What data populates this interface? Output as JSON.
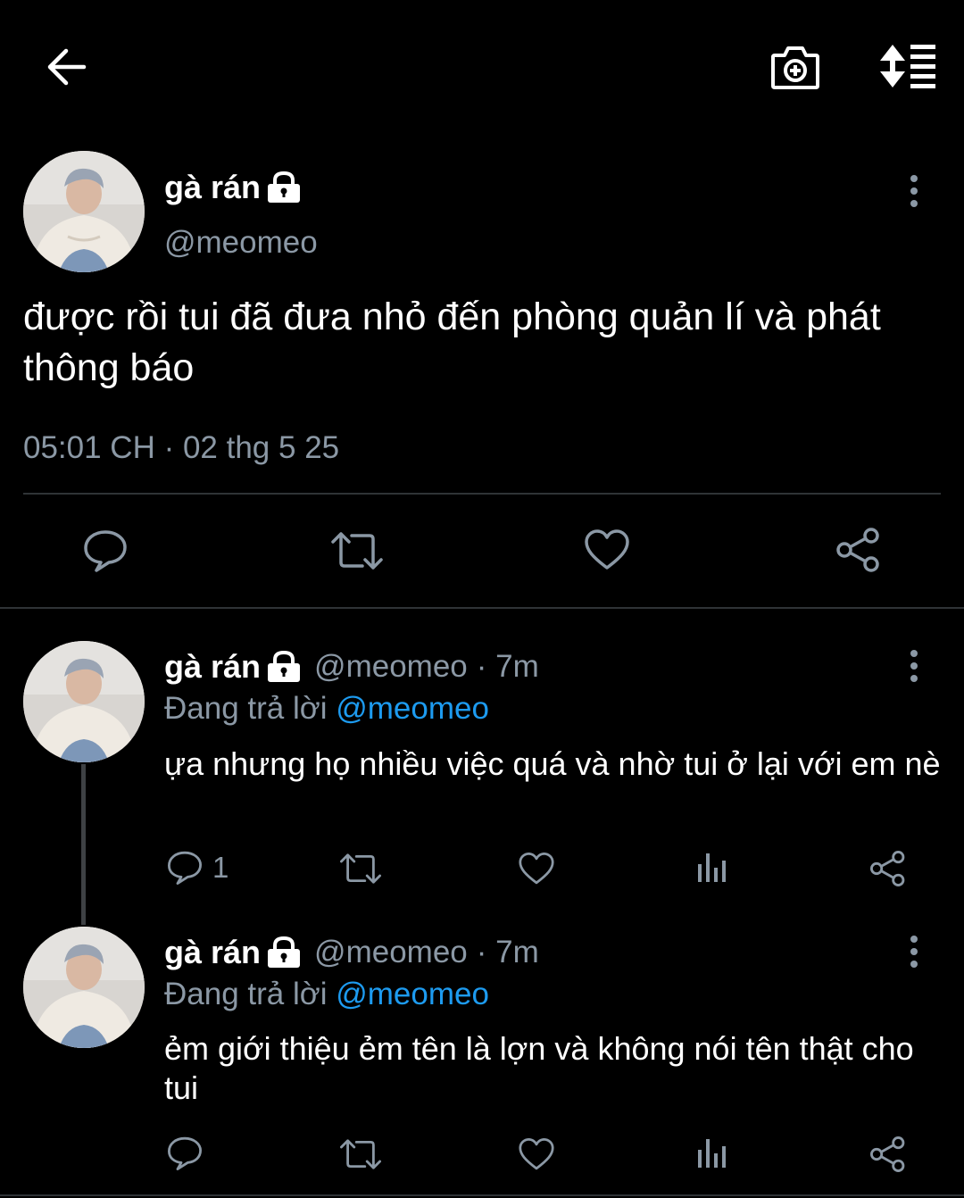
{
  "topbar": {
    "back_icon": "arrow-left-icon",
    "camera_icon": "camera-add-icon",
    "sort_icon": "sort-thread-icon"
  },
  "main_tweet": {
    "display_name": "gà rán",
    "handle": "@meomeo",
    "text": "được rồi tui đã đưa nhỏ đến phòng quản lí và phát thông báo",
    "timestamp": "05:01 CH · 02 thg 5 25"
  },
  "replies": [
    {
      "display_name": "gà rán",
      "handle": "@meomeo",
      "time": "· 7m",
      "replying_prefix": "Đang trả lời",
      "replying_to": "@meomeo",
      "text": "ựa nhưng họ nhiều việc quá và nhờ tui ở lại với em nè",
      "reply_count": "1"
    },
    {
      "display_name": "gà rán",
      "handle": "@meomeo",
      "time": "· 7m",
      "replying_prefix": "Đang trả lời",
      "replying_to": "@meomeo",
      "text": "ẻm giới thiệu ẻm tên là lợn và không nói tên thật cho tui",
      "reply_count": ""
    }
  ],
  "colors": {
    "background": "#000000",
    "text": "#e7e9ea",
    "secondary": "#8b98a5",
    "accent": "#1d9bf0",
    "divider": "#2f3336"
  }
}
